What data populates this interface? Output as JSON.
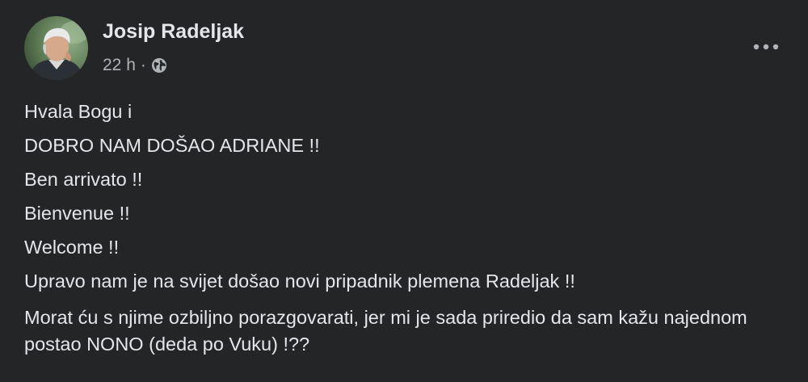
{
  "post": {
    "author": "Josip Radeljak",
    "time": "22 h",
    "separator": "·",
    "visibility_icon": "globe-icon",
    "more_icon": "more-options-icon",
    "lines": [
      "Hvala Bogu i",
      "DOBRO NAM DOŠAO ADRIANE !!",
      "Ben arrivato !!",
      "Bienvenue !!",
      "Welcome !!",
      "Upravo nam je na svijet došao novi pripadnik plemena Radeljak !!"
    ],
    "paragraph": "Morat ću s njime ozbiljno porazgovarati, jer mi je sada priredio da sam kažu najednom postao NONO (deda po Vuku) !??"
  },
  "colors": {
    "background": "#242526",
    "primary_text": "#e4e6eb",
    "secondary_text": "#b0b3b8"
  }
}
